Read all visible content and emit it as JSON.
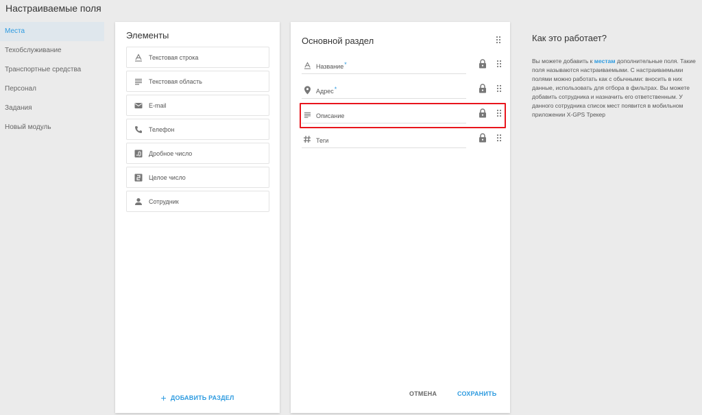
{
  "page": {
    "title": "Настраиваемые поля"
  },
  "sidebar": {
    "items": [
      {
        "label": "Места",
        "active": true
      },
      {
        "label": "Техобслуживание"
      },
      {
        "label": "Транспортные средства"
      },
      {
        "label": "Персонал"
      },
      {
        "label": "Задания"
      },
      {
        "label": "Новый модуль"
      }
    ]
  },
  "elements": {
    "title": "Элементы",
    "items": [
      {
        "label": "Текстовая строка",
        "icon": "text-string-icon"
      },
      {
        "label": "Текстовая область",
        "icon": "text-area-icon"
      },
      {
        "label": "E-mail",
        "icon": "mail-icon"
      },
      {
        "label": "Телефон",
        "icon": "phone-icon"
      },
      {
        "label": "Дробное число",
        "icon": "decimal-icon"
      },
      {
        "label": "Целое число",
        "icon": "integer-icon"
      },
      {
        "label": "Сотрудник",
        "icon": "person-icon"
      }
    ],
    "add_section_label": "ДОБАВИТЬ РАЗДЕЛ"
  },
  "section": {
    "title": "Основной раздел",
    "fields": [
      {
        "label": "Название",
        "required": "*",
        "icon": "text-string-icon"
      },
      {
        "label": "Адрес",
        "required": "*",
        "icon": "location-pin-icon"
      },
      {
        "label": "Описание",
        "required": "",
        "icon": "text-area-icon"
      },
      {
        "label": "Теги",
        "required": "",
        "icon": "hash-icon"
      }
    ],
    "cancel_label": "ОТМЕНА",
    "save_label": "СОХРАНИТЬ"
  },
  "info": {
    "title": "Как это работает?",
    "text_before_link": "Вы можете добавить к ",
    "link": "местам",
    "text_after_link": " дополнительные поля. Такие поля называются настраиваемыми. С настраиваемыми полями можно работать как с обычными: вносить в них данные, использовать для отбора в фильтрах. Вы можете добавить сотрудника и назначить его ответственным. У данного сотрудника список мест появится в мобильном приложении X-GPS Трекер"
  },
  "colors": {
    "accent": "#2e9be0",
    "highlight": "#e8141b",
    "background": "#ebebeb"
  }
}
